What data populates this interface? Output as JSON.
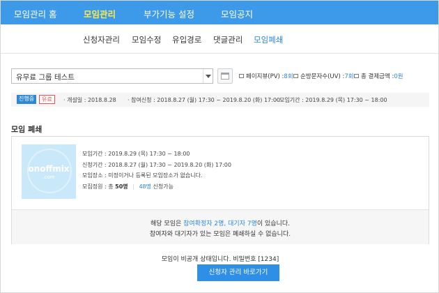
{
  "top_nav": {
    "items": [
      {
        "label": "모임관리 홈"
      },
      {
        "label": "모임관리",
        "active": true
      },
      {
        "label": "부가기능 설정"
      },
      {
        "label": "모임공지"
      }
    ]
  },
  "sub_nav": {
    "items": [
      {
        "label": "신청자관리"
      },
      {
        "label": "모임수정"
      },
      {
        "label": "유입경로"
      },
      {
        "label": "댓글관리"
      },
      {
        "label": "모임폐쇄",
        "active": true
      }
    ]
  },
  "toolbar": {
    "event_select_value": "유무료 그룹 테스트",
    "stats": {
      "pageviews_label": "페이지뷰(PV) :",
      "pageviews_value": "8회",
      "visitors_label": "순방문자수(UV) :",
      "visitors_value": "7회",
      "payment_label": "총 결제금액 :",
      "payment_value": "0원"
    }
  },
  "info_bar": {
    "status_badge": "진행중",
    "paid_badge": "유료",
    "opened": "· 개설일 : 2018.8.28",
    "application_period": "· 참여신청 : 2018.8.27 (월) 17:30 ~ 2019.8.20 (화) 17:00",
    "event_period": "· 모임기간 : 2019.8.29 (목) 17:30 ~ 18:00"
  },
  "section": {
    "title": "모임 폐쇄"
  },
  "event_card": {
    "thumbnail_logo": "onoffmix",
    "thumbnail_sub": ".com",
    "event_period": "모임기간 : 2019.8.29 (목) 17:30 ~ 18:00",
    "application_period": "신청기간 : 2018.8.27 (월) 17:30 ~ 2019.8.20 (화) 17:00",
    "location": "모임장소 : 미정이거나 등록된 모임장소가 없습니다.",
    "capacity_label": "모집정원 : 총",
    "capacity_total": "50명",
    "capacity_applied_num": "48명",
    "capacity_applied_label": "신청가능"
  },
  "notice": {
    "line1_prefix": "해당 모임은",
    "line1_highlight": "참여확정자 2명, 대기자 7명",
    "line1_suffix": "이 있습니다.",
    "line2": "참여자와 대기자가 있는 모임은 폐쇄하실 수 없습니다."
  },
  "footer": {
    "message": "모임이 비공개 상태입니다. 비밀번호 [1234]",
    "cta_label": "신청자 관리 바로가기"
  },
  "colors": {
    "nav_bg": "#3d9ae8",
    "active_nav": "#ffe94a",
    "accent_blue": "#2f87d6",
    "badge_red": "#e25555"
  }
}
